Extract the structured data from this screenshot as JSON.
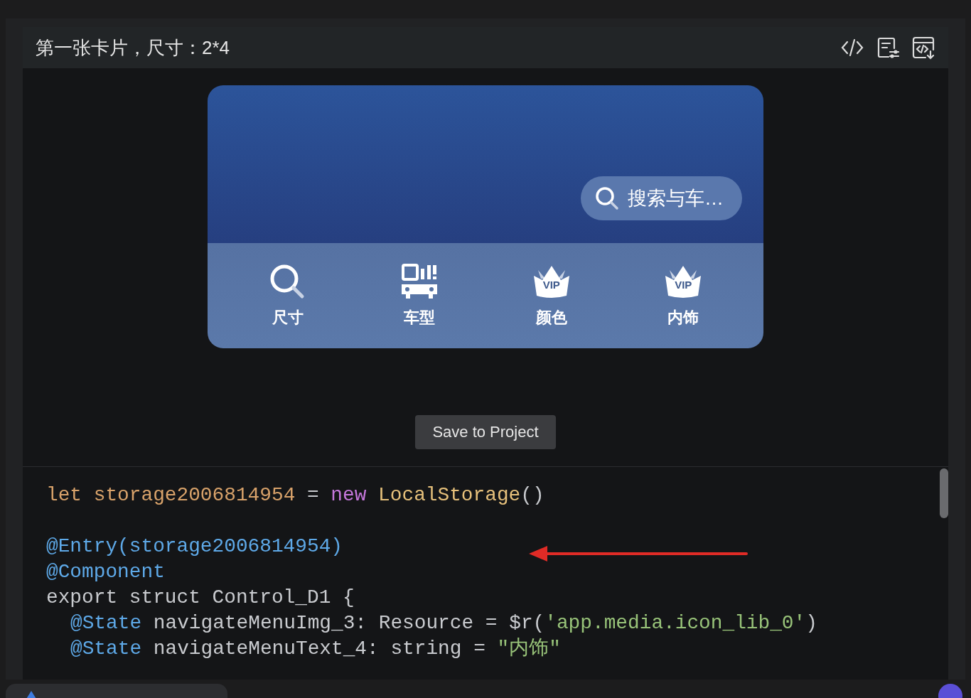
{
  "card_title": "第一张卡片，尺寸：2*4",
  "preview": {
    "search": {
      "text": "搜索与车…"
    },
    "nav_items": [
      {
        "label": "尺寸",
        "kind": "search"
      },
      {
        "label": "车型",
        "kind": "car"
      },
      {
        "label": "颜色",
        "kind": "vip",
        "badge": "VIP"
      },
      {
        "label": "内饰",
        "kind": "vip",
        "badge": "VIP"
      }
    ]
  },
  "save_button": "Save to Project",
  "code_lines": [
    {
      "kind": "top",
      "tokens": [
        {
          "text": "let ",
          "kind": "var"
        },
        {
          "text": "storage2006814954",
          "kind": "var"
        },
        {
          "text": " = ",
          "kind": "plain"
        },
        {
          "text": "new",
          "kind": "keyword"
        },
        {
          "text": " LocalStorage",
          "kind": "class"
        },
        {
          "text": "()",
          "kind": "plain"
        }
      ]
    },
    {
      "kind": "blank"
    },
    {
      "kind": "top",
      "tokens": [
        {
          "text": "@Entry(storage2006814954)",
          "kind": "decorator"
        }
      ]
    },
    {
      "kind": "top",
      "tokens": [
        {
          "text": "@Component",
          "kind": "decorator"
        }
      ]
    },
    {
      "kind": "top",
      "tokens": [
        {
          "text": "export struct Control_D1 {",
          "kind": "plain"
        }
      ]
    },
    {
      "kind": "member",
      "tokens": [
        {
          "text": "@State",
          "kind": "decorator"
        },
        {
          "text": " navigateMenuImg_3: Resource = $r(",
          "kind": "plain"
        },
        {
          "text": "'app.media.icon_lib_0'",
          "kind": "string"
        },
        {
          "text": ")",
          "kind": "plain"
        }
      ]
    },
    {
      "kind": "member",
      "tokens": [
        {
          "text": "@State",
          "kind": "decorator"
        },
        {
          "text": " navigateMenuText_4: string = ",
          "kind": "plain"
        },
        {
          "text": "\"内饰\"",
          "kind": "string"
        }
      ]
    }
  ]
}
